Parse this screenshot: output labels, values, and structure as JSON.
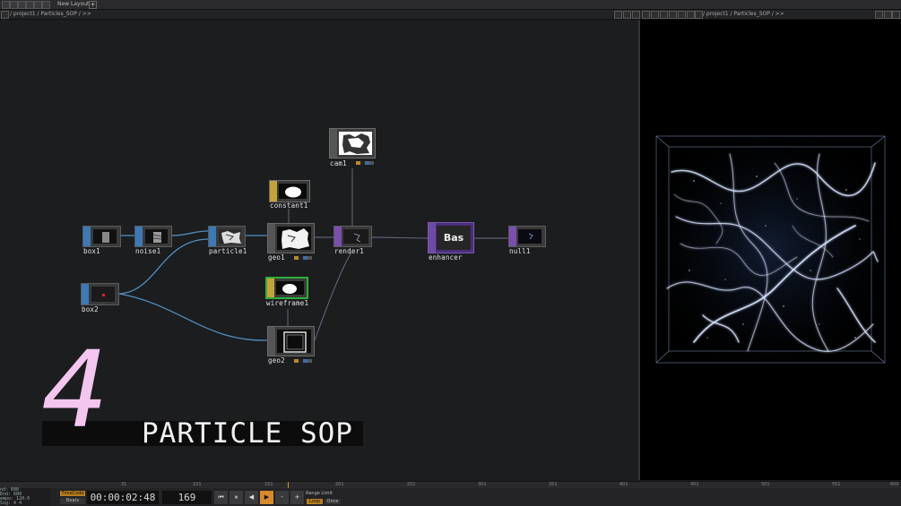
{
  "tabs": {
    "layout_tab": "New Layout",
    "add_tab": "+"
  },
  "network_path": "/ project1 / Particles_SOP / >>",
  "viewer_path": "/ project1 / Particles_SOP / >>",
  "nodes": {
    "cam1": "cam1",
    "constant1": "constant1",
    "box1": "box1",
    "noise1": "noise1",
    "particle1": "particle1",
    "geo1": "geo1",
    "render1": "render1",
    "enhancer": "enhancer",
    "enhancer_thumb": "Bas",
    "null1": "null1",
    "box2": "box2",
    "wireframe1": "wireframe1",
    "geo2": "geo2"
  },
  "title": {
    "number": "4",
    "text": "PARTICLE SOP"
  },
  "ruler_ticks": [
    "31",
    "101",
    "151",
    "201",
    "251",
    "301",
    "351",
    "401",
    "451",
    "501",
    "551",
    "600"
  ],
  "timeline": {
    "info": [
      "nd: 600",
      "End: 600",
      "empo: 120.0",
      "Sig: 4 4"
    ],
    "timecode_label": "TimeCode",
    "beats_label": "Beats",
    "time": "00:00:02:48",
    "frame": "169",
    "buttons": [
      "⏮",
      "⏸",
      "◀",
      "▶",
      "-",
      "+"
    ],
    "range_label": "Range Limit",
    "loop_label": "Loop",
    "once_label": "Once"
  },
  "colors": {
    "sop_flag": "#3b79b8",
    "comp_flag": "#c4a43a",
    "tex_flag": "#7a4fb0",
    "wire_blue": "#4f8fc0",
    "title_pink": "#f3c6ef",
    "play_active": "#d68a2b"
  }
}
